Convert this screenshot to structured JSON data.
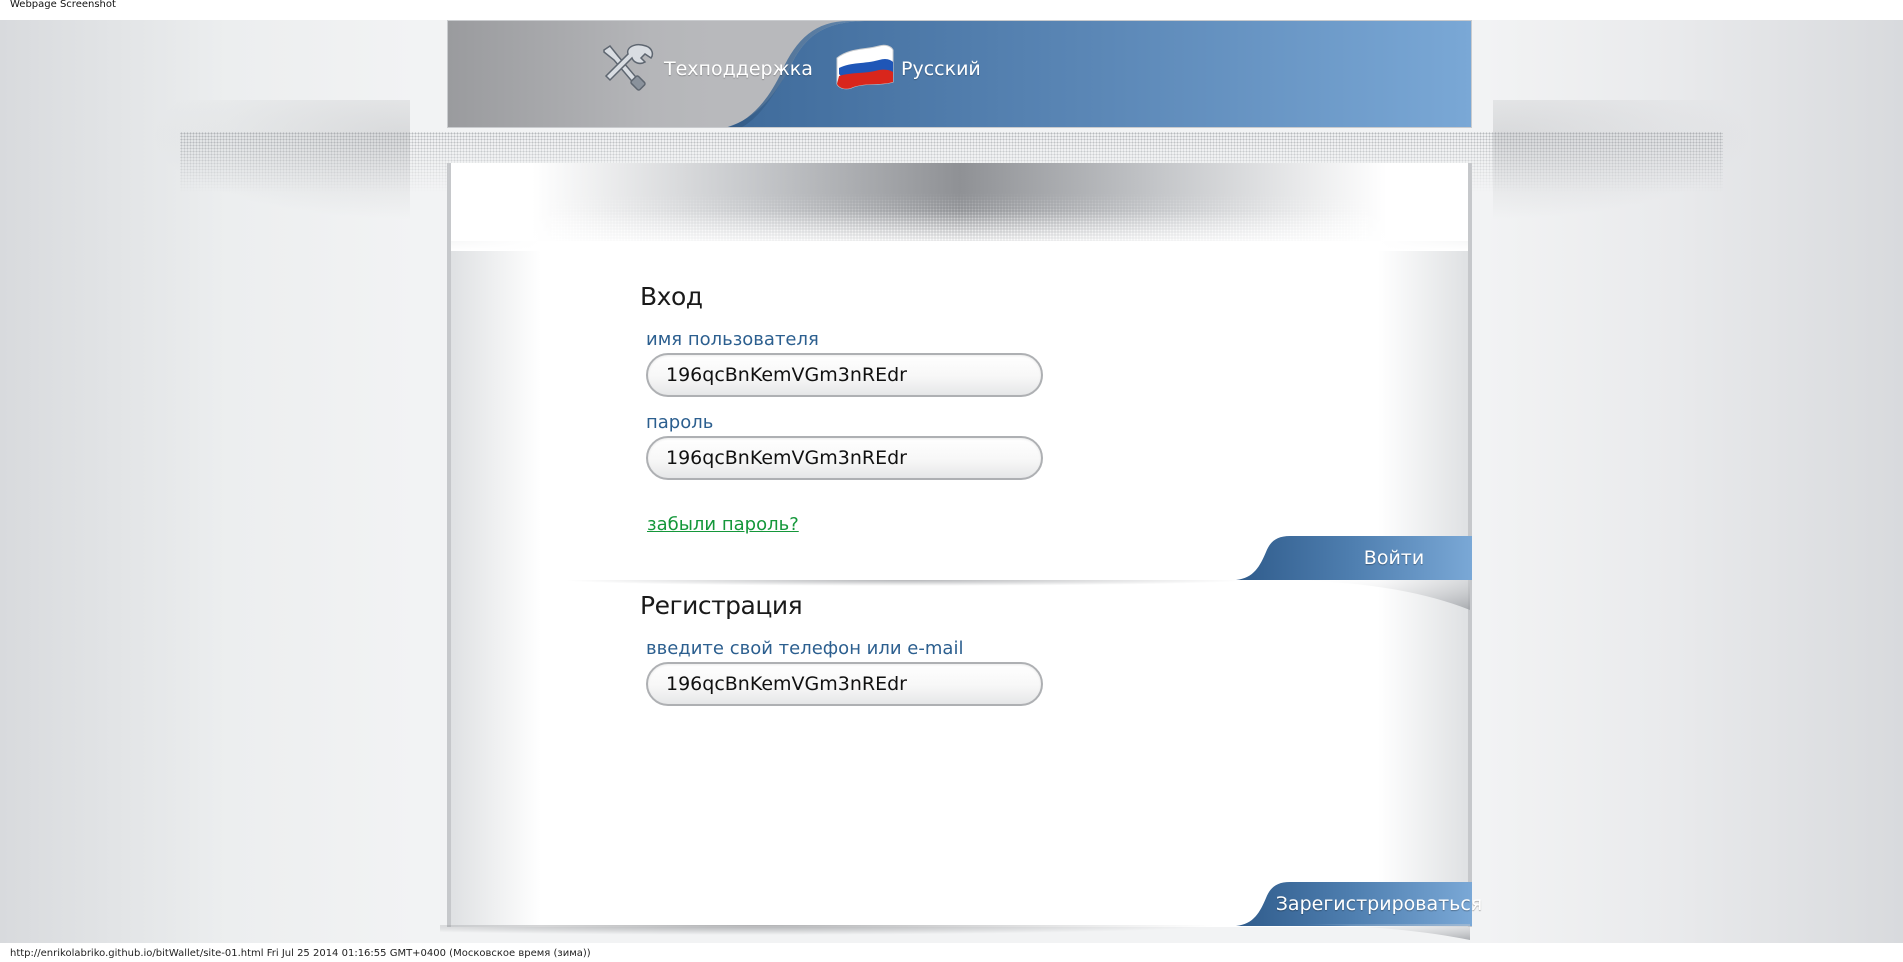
{
  "window": {
    "caption": "Webpage Screenshot"
  },
  "header": {
    "support_label": "Техподдержка",
    "language_label": "Русский"
  },
  "login": {
    "title": "Вход",
    "username_label": "имя пользователя",
    "username_value": "196qcBnKemVGm3nREdr",
    "password_label": "пароль",
    "password_value": "196qcBnKemVGm3nREdr",
    "forgot_link": "забыли пароль?",
    "submit_label": "Войти"
  },
  "register": {
    "title": "Регистрация",
    "contact_label": "введите свой телефон или e-mail",
    "contact_value": "196qcBnKemVGm3nREdr",
    "submit_label": "Зарегистрироваться"
  },
  "status": {
    "text": "http://enrikolabriko.github.io/bitWallet/site-01.html Fri Jul 25 2014 01:16:55 GMT+0400 (Московское время (зима))"
  },
  "colors": {
    "brand_blue": "#4d7bab",
    "label_blue": "#2c5f8f",
    "link_green": "#14973a"
  },
  "icons": {
    "support": "tools-icon",
    "language": "russian-flag-icon"
  }
}
